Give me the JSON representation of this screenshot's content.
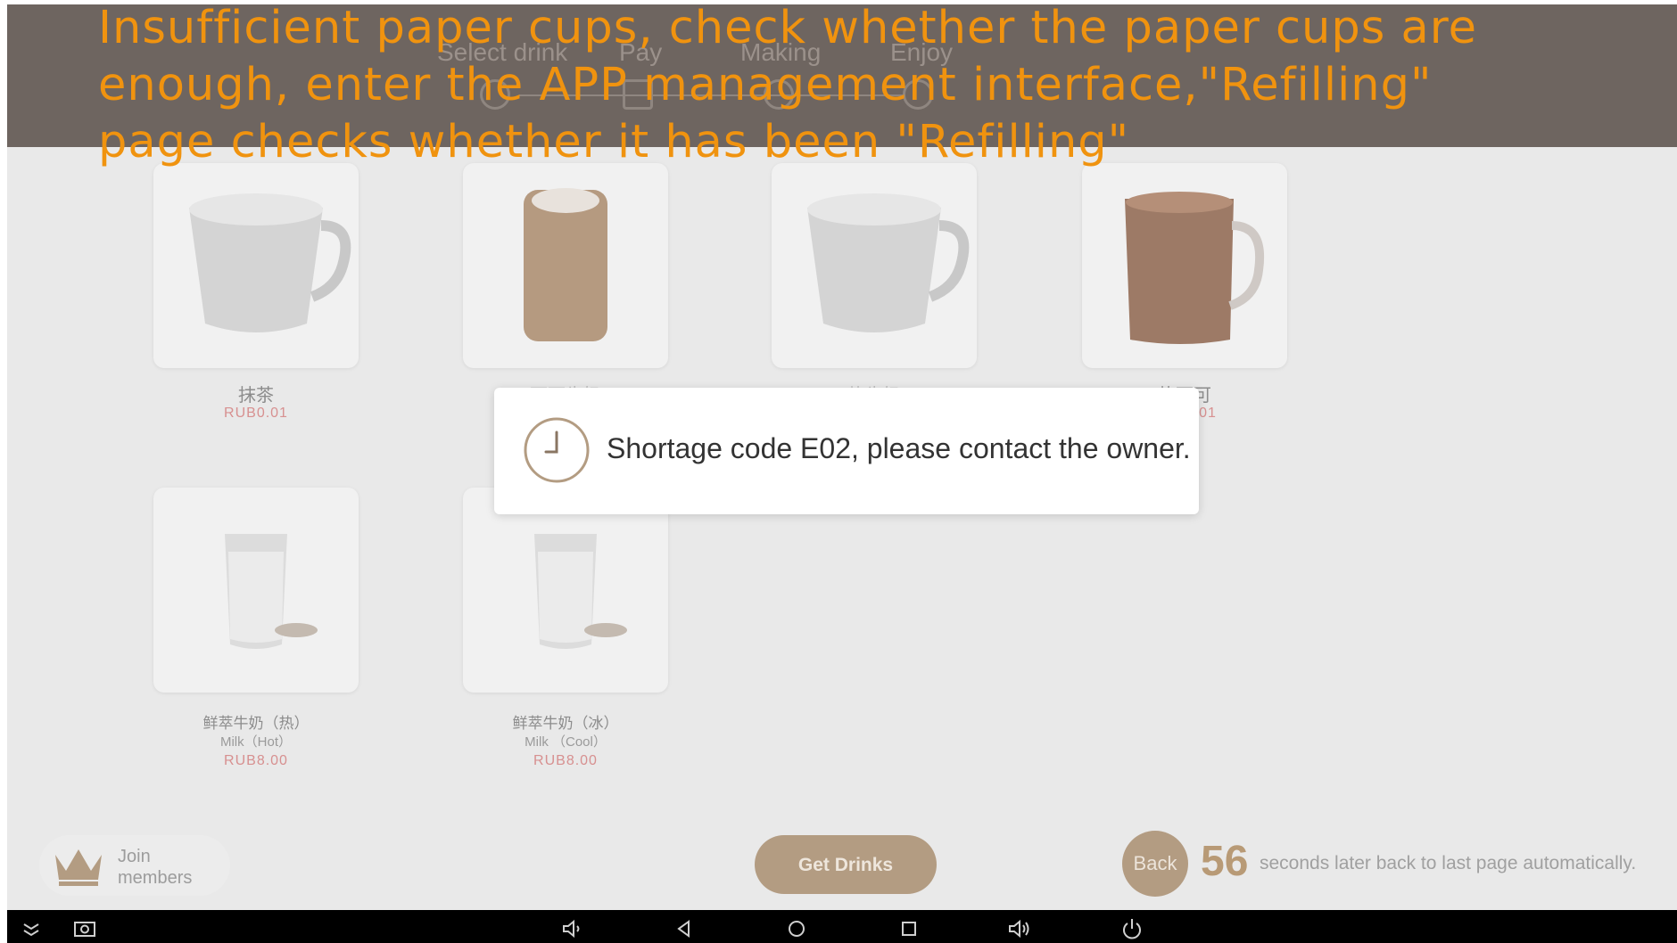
{
  "annotation": {
    "text": "Insufficient paper cups, check whether the paper cups are enough, enter the APP management interface,\"Refilling\" page checks whether it has been \"Refilling\""
  },
  "steps": {
    "select": "Select drink",
    "pay": "Pay",
    "making": "Making",
    "enjoy": "Enjoy"
  },
  "products": [
    {
      "name_cn": "抹茶",
      "name_en": "",
      "price": "RUB0.01",
      "image": "white-mug"
    },
    {
      "name_cn": "可可牛奶",
      "name_en": "",
      "price": "",
      "image": "latte-glass"
    },
    {
      "name_cn": "热牛奶",
      "name_en": "",
      "price": "",
      "image": "white-mug"
    },
    {
      "name_cn": "热可可",
      "name_en": "",
      "price": "RUB0.01",
      "image": "cocoa-mug"
    },
    {
      "name_cn": "鲜萃牛奶（热）",
      "name_en": "Milk（Hot）",
      "price": "RUB8.00",
      "image": "milk-glass"
    },
    {
      "name_cn": "鲜萃牛奶（冰）",
      "name_en": "Milk （Cool）",
      "price": "RUB8.00",
      "image": "milk-glass"
    }
  ],
  "dialog": {
    "message": "Shortage code E02, please contact the owner.",
    "icon": "clock-icon"
  },
  "footer": {
    "join_label": "Join\nmembers",
    "get_drinks": "Get Drinks",
    "back": "Back",
    "countdown": "56",
    "countdown_text": "seconds later back to last page automatically."
  },
  "navbar": {
    "icons": [
      "collapse-icon",
      "screenshot-icon",
      "volume-down-icon",
      "back-icon",
      "home-icon",
      "recents-icon",
      "volume-up-icon",
      "power-icon"
    ]
  },
  "colors": {
    "header": "#6e6560",
    "annotation": "#f0930f",
    "accent": "#b39c82",
    "price": "#d79090"
  }
}
